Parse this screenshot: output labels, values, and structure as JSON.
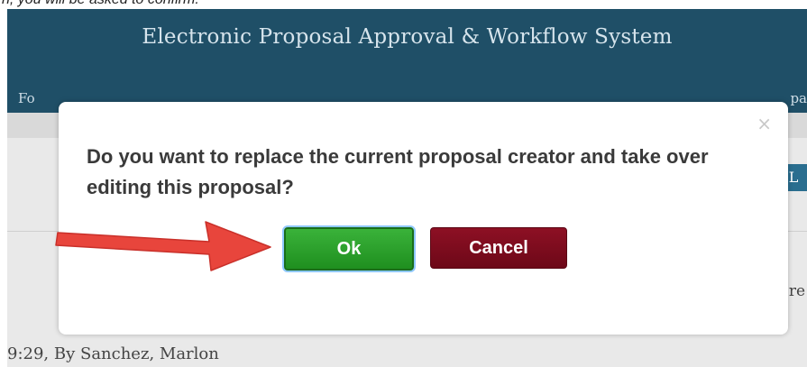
{
  "caption": {
    "text": "n, you will be asked to confirm."
  },
  "header": {
    "title": "Electronic Proposal Approval & Workflow System",
    "nav_left": "Fo",
    "nav_right": "pa"
  },
  "background": {
    "edge_button": "L",
    "edge_text": "re",
    "footer_text": "9:29, By Sanchez, Marlon"
  },
  "dialog": {
    "close_glyph": "×",
    "message": "Do you want to replace the current proposal creator and take over editing this proposal?",
    "ok_label": "Ok",
    "cancel_label": "Cancel"
  },
  "colors": {
    "header_bg": "#1f4f67",
    "ok_green": "#2aa12a",
    "cancel_red": "#7d0c1e",
    "arrow_red": "#e8453c"
  }
}
